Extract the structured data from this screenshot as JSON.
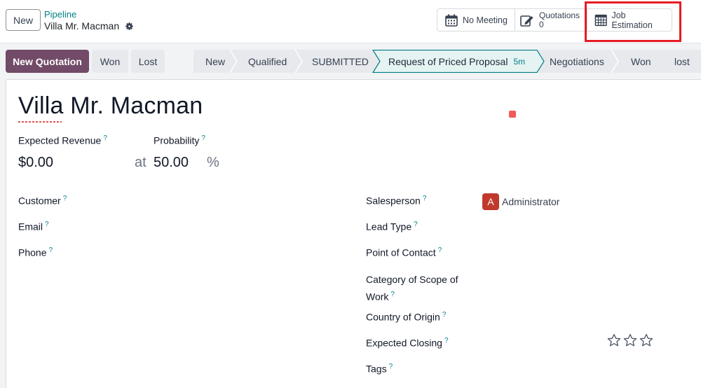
{
  "header": {
    "new_label": "New",
    "breadcrumb_parent": "Pipeline",
    "breadcrumb_current": "Villa Mr. Macman"
  },
  "smart_buttons": {
    "meeting_label": "No Meeting",
    "quotations_label": "Quotations",
    "quotations_count": "0",
    "job_estimation_label": "Job Estimation",
    "highlight_color": "#e51c23"
  },
  "actions": {
    "new_quotation": "New Quotation",
    "won": "Won",
    "lost": "Lost"
  },
  "stages": [
    {
      "label": "New"
    },
    {
      "label": "Qualified"
    },
    {
      "label": "SUBMITTED"
    },
    {
      "label": "Request of Priced Proposal",
      "time": "5m",
      "active": true
    },
    {
      "label": "Negotiations"
    },
    {
      "label": "Won"
    },
    {
      "label": "lost"
    }
  ],
  "form": {
    "title": "Villa Mr. Macman",
    "expected_revenue_label": "Expected Revenue",
    "expected_revenue": "$0.00",
    "at_label": "at",
    "probability_label": "Probability",
    "probability": "50.00",
    "percent": "%",
    "tooltip_mark": "?",
    "left_fields": [
      "Customer",
      "Email",
      "Phone"
    ],
    "right_fields": {
      "salesperson": "Salesperson",
      "lead_type": "Lead Type",
      "point_of_contact": "Point of Contact",
      "category_line1": "Category of Scope of",
      "category_line2": "Work",
      "country": "Country of Origin",
      "expected_closing": "Expected Closing",
      "tags": "Tags"
    },
    "salesperson_initial": "A",
    "salesperson_name": "Administrator",
    "priority_stars_filled": 0,
    "priority_stars_total": 3
  },
  "colors": {
    "brand": "#714b67",
    "accent": "#017e84",
    "active_stage_bg": "#e6f3f3",
    "avatar": "#c0392b"
  }
}
